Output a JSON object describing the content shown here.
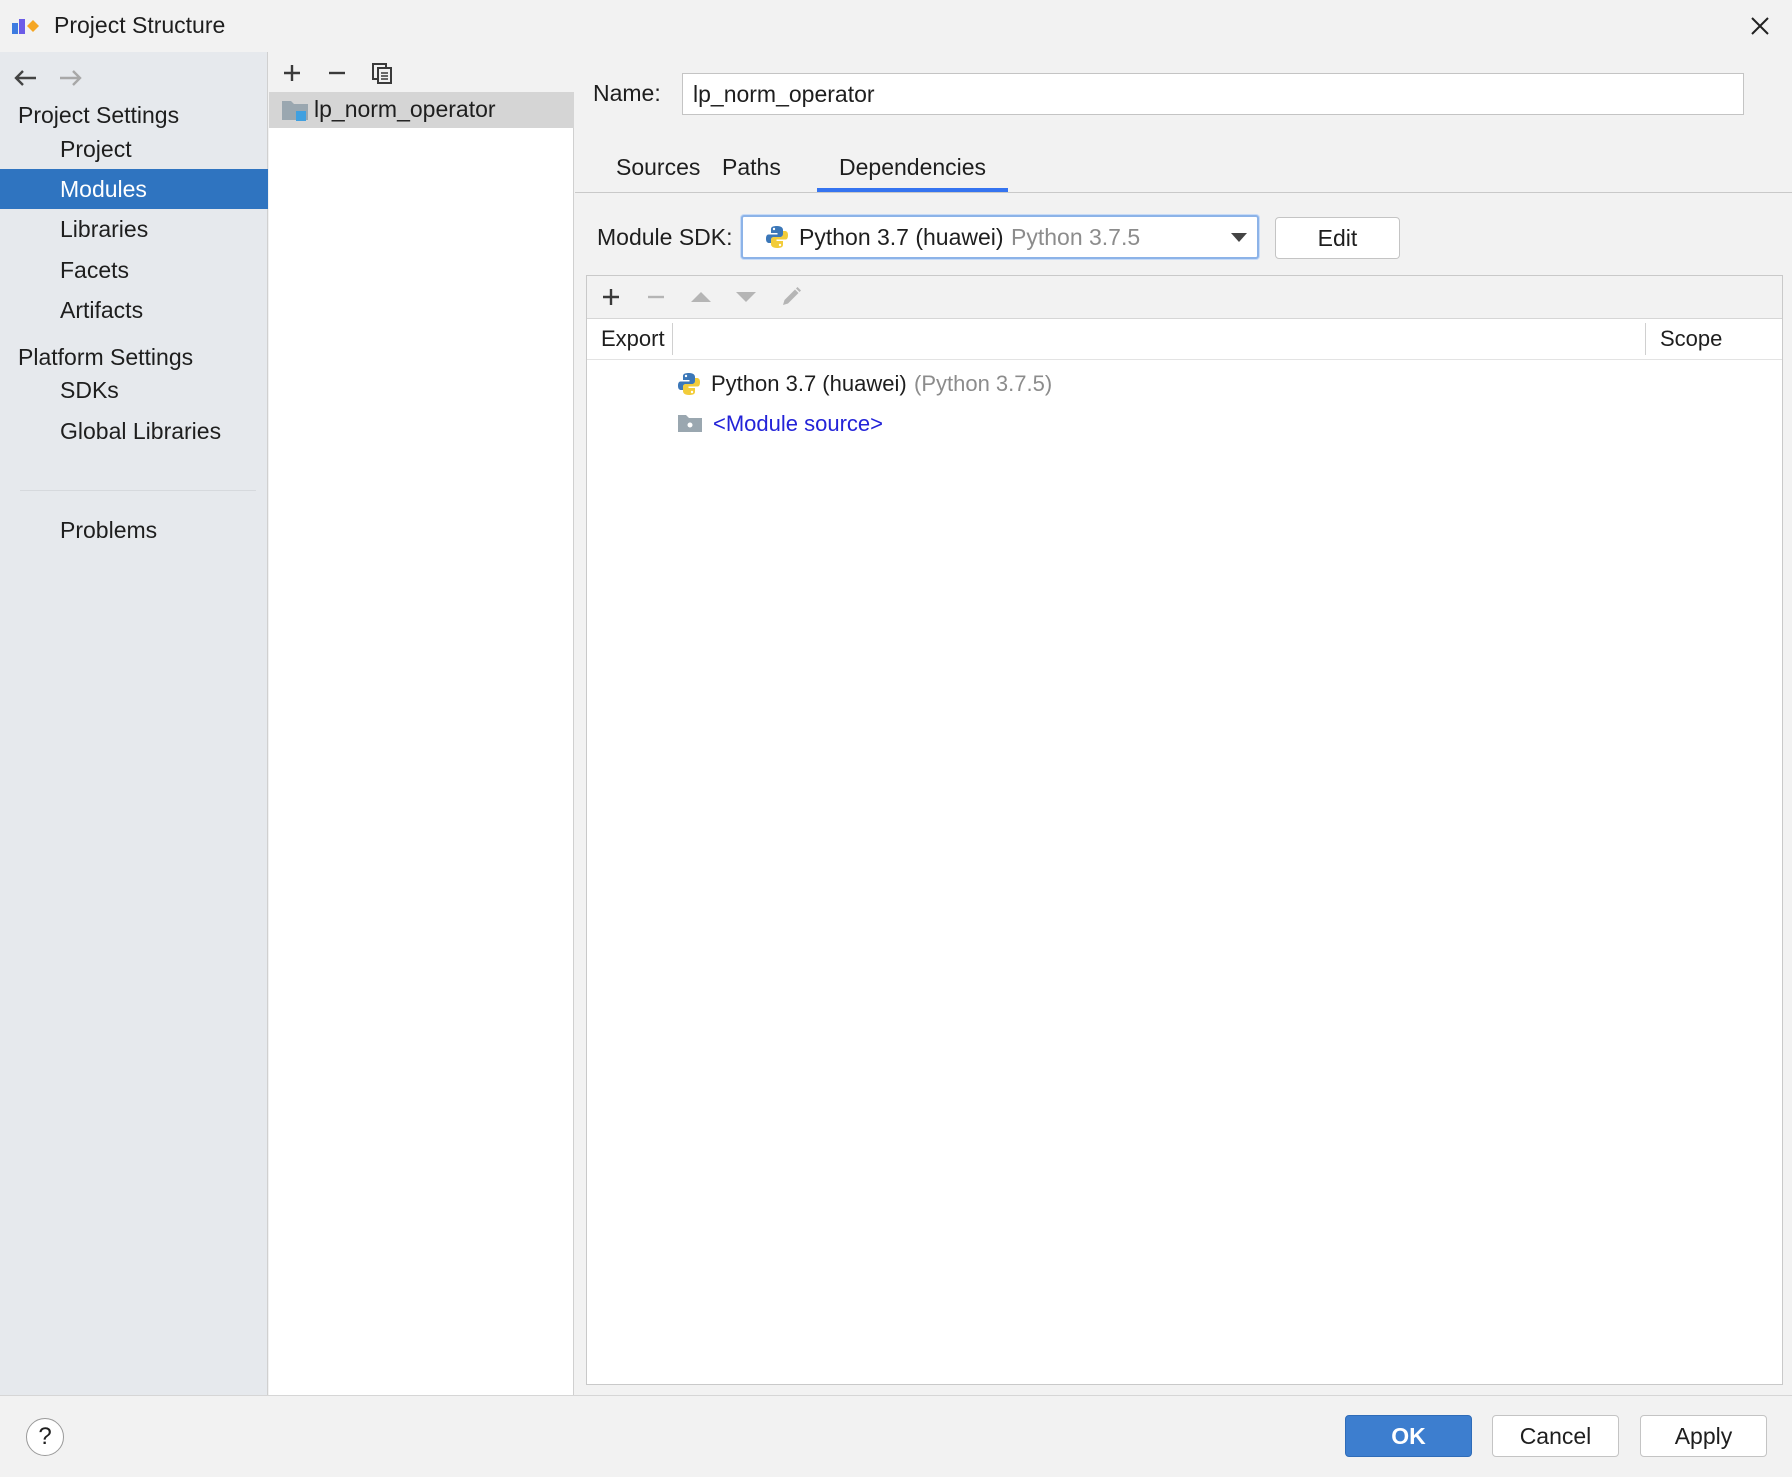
{
  "window": {
    "title": "Project Structure"
  },
  "nav": {
    "project_settings_heading": "Project Settings",
    "project_settings_items": [
      "Project",
      "Modules",
      "Libraries",
      "Facets",
      "Artifacts"
    ],
    "selected_item": "Modules",
    "platform_settings_heading": "Platform Settings",
    "platform_settings_items": [
      "SDKs",
      "Global Libraries"
    ],
    "problems_label": "Problems"
  },
  "modules": {
    "items": [
      "lp_norm_operator"
    ]
  },
  "detail": {
    "name_label": "Name:",
    "name_value": "lp_norm_operator",
    "tabs": [
      "Sources",
      "Paths",
      "Dependencies"
    ],
    "active_tab": "Dependencies",
    "module_sdk_label": "Module SDK:",
    "module_sdk_name": "Python 3.7 (huawei)",
    "module_sdk_version": "Python 3.7.5",
    "edit_label": "Edit",
    "columns": {
      "export": "Export",
      "scope": "Scope"
    },
    "dependencies": [
      {
        "name": "Python 3.7 (huawei)",
        "detail": "(Python 3.7.5)",
        "icon": "python-icon"
      },
      {
        "name": "<Module source>",
        "icon": "folder-icon"
      }
    ]
  },
  "buttons": {
    "ok": "OK",
    "cancel": "Cancel",
    "apply": "Apply",
    "help": "?"
  },
  "colors": {
    "selection": "#2f74c0",
    "tab_underline": "#3574f0",
    "link": "#2323d8",
    "ok_button": "#3d7ecf"
  }
}
